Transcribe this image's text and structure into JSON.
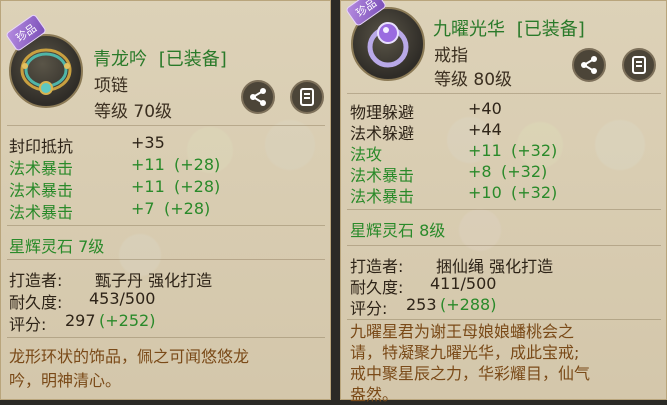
{
  "left": {
    "badge": "珍品",
    "name": "青龙吟",
    "equipped": "[已装备]",
    "slot": "项链",
    "level": "等级  70级",
    "stats": [
      {
        "label": "封印抵抗",
        "value": "+35",
        "extra": "",
        "color": "black"
      },
      {
        "label": "法术暴击",
        "value": "+11",
        "extra": "(+28)",
        "color": "green"
      },
      {
        "label": "法术暴击",
        "value": "+11",
        "extra": "(+28)",
        "color": "green"
      },
      {
        "label": "法术暴击",
        "value": "+7",
        "extra": "(+28)",
        "color": "green"
      }
    ],
    "gem": "星辉灵石  7级",
    "forge_label": "打造者:",
    "forge_value": "甄子丹  强化打造",
    "durability_label": "耐久度:",
    "durability_value": "453/500",
    "score_label": "评分:",
    "score_value": "297",
    "score_bonus": "(+252)",
    "desc": [
      "龙形环状的饰品，佩之可闻悠悠龙",
      "吟，明神清心。"
    ]
  },
  "right": {
    "badge": "珍品",
    "name": "九曜光华",
    "equipped": "[已装备]",
    "slot": "戒指",
    "level": "等级  80级",
    "stats": [
      {
        "label": "物理躲避",
        "value": "+40",
        "extra": "",
        "color": "black"
      },
      {
        "label": "法术躲避",
        "value": "+44",
        "extra": "",
        "color": "black"
      },
      {
        "label": "法攻",
        "value": "+11",
        "extra": "(+32)",
        "color": "green"
      },
      {
        "label": "法术暴击",
        "value": "+8",
        "extra": "(+32)",
        "color": "green"
      },
      {
        "label": "法术暴击",
        "value": "+10",
        "extra": "(+32)",
        "color": "green"
      }
    ],
    "gem": "星辉灵石  8级",
    "forge_label": "打造者:",
    "forge_value": "捆仙绳  强化打造",
    "durability_label": "耐久度:",
    "durability_value": "411/500",
    "score_label": "评分:",
    "score_value": "253",
    "score_bonus": "(+288)",
    "desc": [
      "九曜星君为谢王母娘娘蟠桃会之",
      "请，特凝聚九曜光华，成此宝戒;",
      "戒中聚星辰之力，华彩耀目，仙气",
      "盎然。"
    ]
  },
  "icons": [
    "share-icon",
    "detail-icon"
  ]
}
